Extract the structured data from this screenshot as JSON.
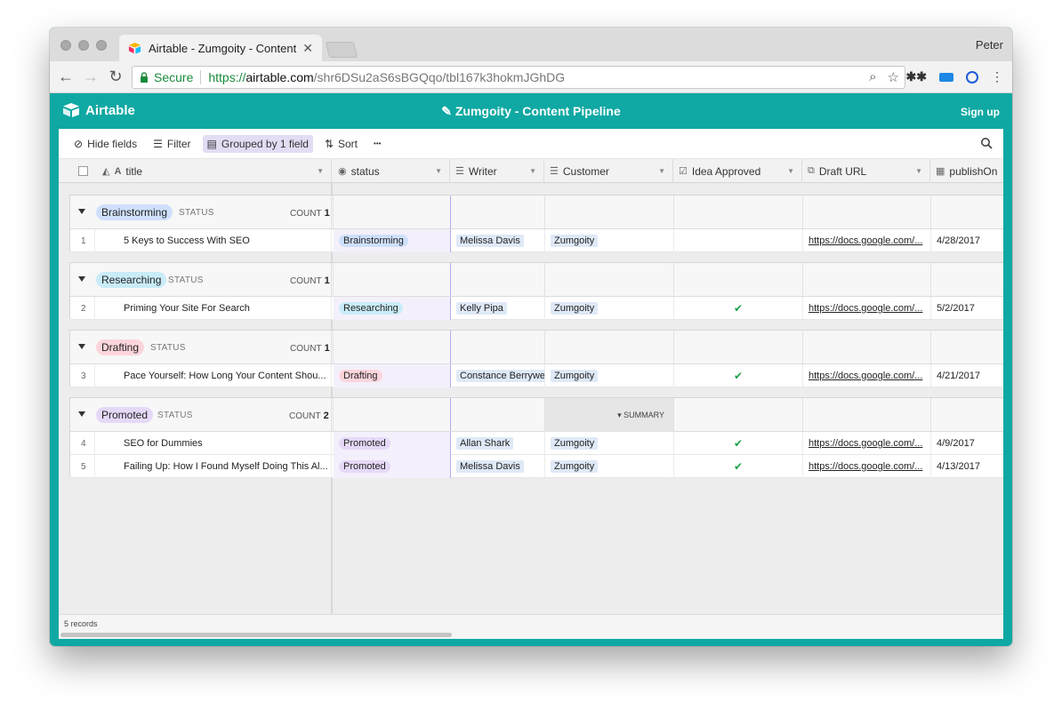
{
  "browser": {
    "tab_title": "Airtable - Zumgoity - Content",
    "profile_name": "Peter",
    "secure_label": "Secure",
    "url_scheme": "https://",
    "url_host": "airtable.com",
    "url_path": "/shr6DSu2aS6sBGQqo/tbl167k3hokmJGhDG"
  },
  "app": {
    "logo_text": "Airtable",
    "base_title": "Zumgoity - Content Pipeline",
    "signup_label": "Sign up"
  },
  "viewbar": {
    "hide_fields": "Hide fields",
    "filter": "Filter",
    "grouped": "Grouped by 1 field",
    "sort": "Sort",
    "more": "•••"
  },
  "columns": [
    "title",
    "status",
    "Writer",
    "Customer",
    "Idea Approved",
    "Draft URL",
    "publishOn"
  ],
  "group_field_label": "STATUS",
  "count_label": "COUNT",
  "summary_label": "SUMMARY",
  "groups": [
    {
      "name": "Brainstorming",
      "color": "#cfe0fc",
      "count": "1",
      "rows": [
        {
          "num": "1",
          "title": "5 Keys to Success With SEO",
          "status": "Brainstorming",
          "writer": "Melissa Davis",
          "customer": "Zumgoity",
          "approved": "",
          "url": "https://docs.google.com/...",
          "publish": "4/28/2017"
        }
      ]
    },
    {
      "name": "Researching",
      "color": "#c9ecf8",
      "count": "1",
      "rows": [
        {
          "num": "2",
          "title": "Priming Your Site For Search",
          "status": "Researching",
          "writer": "Kelly Pipa",
          "customer": "Zumgoity",
          "approved": "✔",
          "url": "https://docs.google.com/...",
          "publish": "5/2/2017"
        }
      ]
    },
    {
      "name": "Drafting",
      "color": "#fcd5dc",
      "count": "1",
      "rows": [
        {
          "num": "3",
          "title": "Pace Yourself: How Long Your Content Shou...",
          "status": "Drafting",
          "writer": "Constance Berrywe",
          "customer": "Zumgoity",
          "approved": "✔",
          "url": "https://docs.google.com/...",
          "publish": "4/21/2017"
        }
      ]
    },
    {
      "name": "Promoted",
      "color": "#e6d9f8",
      "count": "2",
      "rows": [
        {
          "num": "4",
          "title": "SEO for Dummies",
          "status": "Promoted",
          "writer": "Allan Shark",
          "customer": "Zumgoity",
          "approved": "✔",
          "url": "https://docs.google.com/...",
          "publish": "4/9/2017"
        },
        {
          "num": "5",
          "title": "Failing Up: How I Found Myself Doing This Al...",
          "status": "Promoted",
          "writer": "Melissa Davis",
          "customer": "Zumgoity",
          "approved": "✔",
          "url": "https://docs.google.com/...",
          "publish": "4/13/2017"
        }
      ]
    }
  ],
  "footer": {
    "records": "5 records"
  },
  "colors": {
    "brand": "#0fa8a3",
    "check": "#1ea34c",
    "active_view": "#e3dcf4"
  }
}
